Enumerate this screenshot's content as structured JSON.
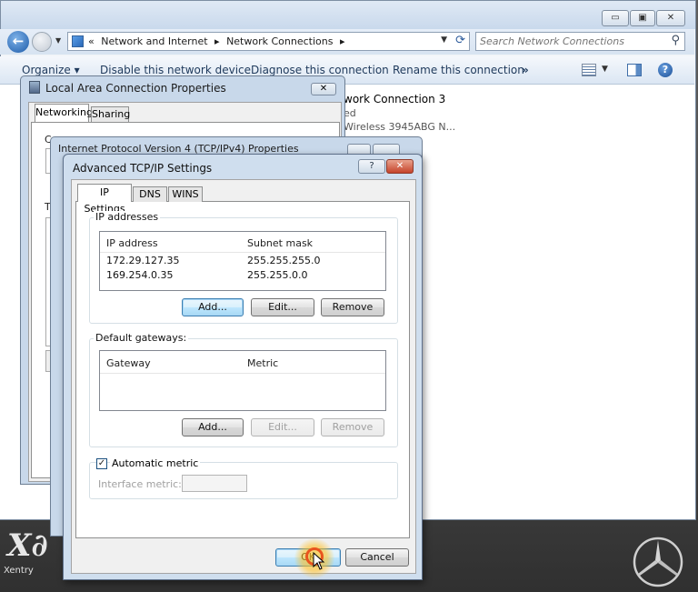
{
  "desktop": {
    "logo_text": "Xentry",
    "logo_subtext": ""
  },
  "explorer": {
    "window_buttons": {
      "minimize": "▭",
      "maximize": "▣",
      "close": "✕"
    },
    "address": {
      "prefix": "«",
      "crumbs": [
        "Network and Internet",
        "▸",
        "Network Connections",
        "▸"
      ]
    },
    "search_placeholder": "Search Network Connections",
    "toolbar": {
      "organize": "Organize ▾",
      "disable": "Disable this network device",
      "diagnose": "Diagnose this connection",
      "rename": "Rename this connection",
      "more": "»"
    },
    "connection": {
      "name": "work Connection 3",
      "status": "ed",
      "adapter": "Wireless 3945ABG N..."
    }
  },
  "lac_dialog": {
    "title": "Local Area Connection Properties",
    "tabs": [
      "Networking",
      "Sharing"
    ],
    "fragments": [
      "Co",
      "T"
    ]
  },
  "ipv4_dialog": {
    "title": "Internet Protocol Version 4 (TCP/IPv4) Properties"
  },
  "advanced": {
    "title": "Advanced TCP/IP Settings",
    "title_help": "?",
    "title_close": "✕",
    "tabs": [
      "IP Settings",
      "DNS",
      "WINS"
    ],
    "ip_addresses": {
      "label": "IP addresses",
      "col_ip": "IP address",
      "col_mask": "Subnet mask",
      "rows": [
        {
          "ip": "172.29.127.35",
          "mask": "255.255.255.0"
        },
        {
          "ip": "169.254.0.35",
          "mask": "255.255.0.0"
        }
      ],
      "add": "Add...",
      "edit": "Edit...",
      "remove": "Remove"
    },
    "gateways": {
      "label": "Default gateways:",
      "col_gateway": "Gateway",
      "col_metric": "Metric",
      "add": "Add...",
      "edit": "Edit...",
      "remove": "Remove"
    },
    "automatic_metric": {
      "label": "Automatic metric",
      "checked": true
    },
    "interface_metric_label": "Interface metric:",
    "ok": "OK",
    "cancel": "Cancel"
  }
}
